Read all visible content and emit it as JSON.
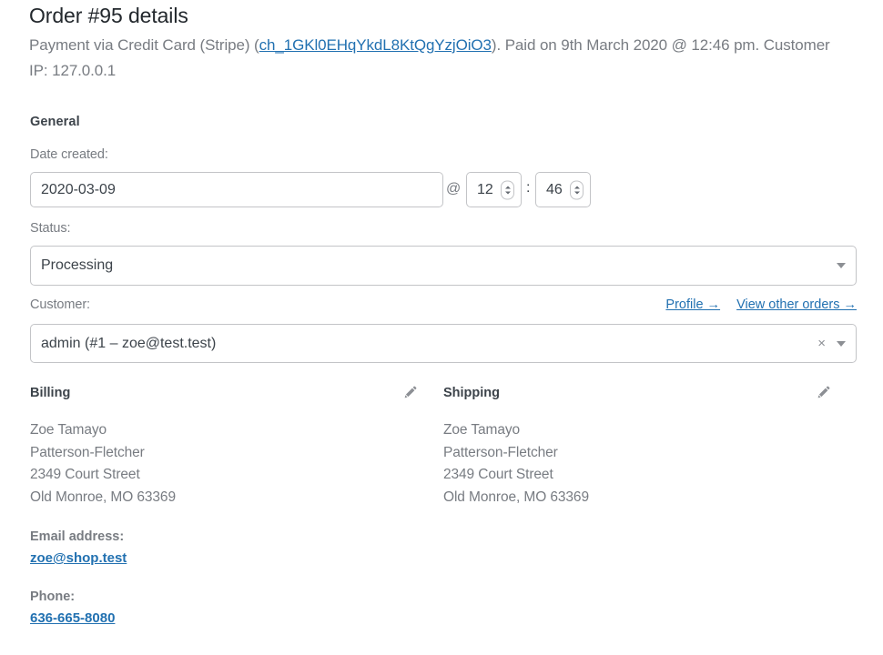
{
  "header": {
    "title": "Order #95 details",
    "meta_prefix": "Payment via Credit Card (Stripe) (",
    "transaction_id": "ch_1GKl0EHqYkdL8KtQgYzjOiO3",
    "meta_suffix": "). Paid on 9th March 2020 @ 12:46 pm. Customer IP: 127.0.0.1"
  },
  "general": {
    "heading": "General",
    "date_created_label": "Date created:",
    "date_value": "2020-03-09",
    "at_symbol": "@",
    "hour_value": "12",
    "colon": ":",
    "minute_value": "46",
    "status_label": "Status:",
    "status_value": "Processing",
    "customer_label": "Customer:",
    "customer_value": "admin (#1 – zoe@test.test)",
    "clear_symbol": "×",
    "profile_link": "Profile →",
    "view_orders_link": "View other orders →"
  },
  "billing": {
    "heading": "Billing",
    "lines": [
      "Zoe Tamayo",
      "Patterson-Fletcher",
      "2349 Court Street",
      "Old Monroe, MO 63369"
    ],
    "email_label": "Email address:",
    "email_value": "zoe@shop.test",
    "phone_label": "Phone:",
    "phone_value": "636-665-8080"
  },
  "shipping": {
    "heading": "Shipping",
    "lines": [
      "Zoe Tamayo",
      "Patterson-Fletcher",
      "2349 Court Street",
      "Old Monroe, MO 63369"
    ]
  },
  "colors": {
    "link": "#2271b1",
    "muted_text": "#787c82",
    "body_text": "#3c434a",
    "border": "#c3c4c7"
  }
}
